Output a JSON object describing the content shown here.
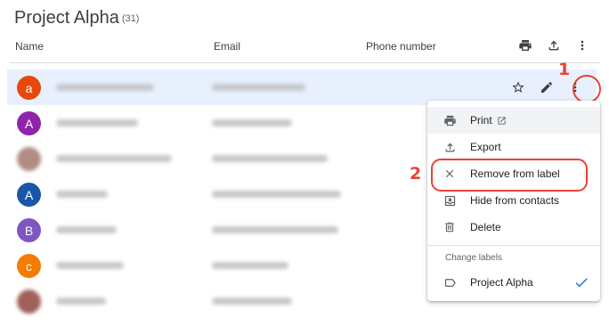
{
  "header": {
    "title": "Project Alpha",
    "count": "(31)"
  },
  "columns": {
    "name": "Name",
    "email": "Email",
    "phone": "Phone number"
  },
  "header_actions": [
    "print-icon",
    "export-icon",
    "more-vert-icon"
  ],
  "contacts": [
    {
      "initial": "a",
      "color": "#e8480c",
      "selected": true
    },
    {
      "initial": "A",
      "color": "#8e24aa"
    },
    {
      "initial": "",
      "color": "#b08c84"
    },
    {
      "initial": "A",
      "color": "#1a56a8"
    },
    {
      "initial": "B",
      "color": "#7e57c2"
    },
    {
      "initial": "c",
      "color": "#f57c00"
    },
    {
      "initial": "",
      "color": "#a1605a"
    }
  ],
  "row_actions": [
    "star-icon",
    "edit-icon",
    "more-vert-icon"
  ],
  "menu": {
    "print": "Print",
    "export": "Export",
    "remove": "Remove from label",
    "hide": "Hide from contacts",
    "delete": "Delete",
    "section": "Change labels",
    "label": "Project Alpha"
  },
  "annotations": {
    "step1": "1",
    "step2": "2"
  },
  "colors": {
    "accent": "#1a73e8",
    "selected_row": "#e8f0fe",
    "annotation": "#e94235"
  }
}
